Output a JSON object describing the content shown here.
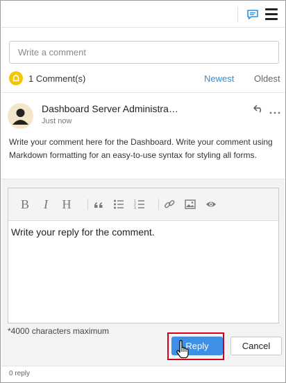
{
  "header": {
    "comment_icon": "comment-icon",
    "menu_icon": "hamburger-menu-icon",
    "accent": "#2f8fd8"
  },
  "new_comment": {
    "placeholder": "Write a comment"
  },
  "summary": {
    "count_label": "1 Comment(s)",
    "sort_newest": "Newest",
    "sort_oldest": "Oldest",
    "bell_color": "#f2c600"
  },
  "comment": {
    "author": "Dashboard Server Administra…",
    "time": "Just now",
    "text": "Write your comment here for the Dashboard. Write your comment using Markdown formatting for an easy-to-use syntax for styling all forms.",
    "reply_icon": "reply-icon",
    "more_icon": "more-options-icon"
  },
  "editor": {
    "toolbar": {
      "bold": "B",
      "italic": "I",
      "heading": "H",
      "icons": [
        "quote-icon",
        "bulleted-list-icon",
        "numbered-list-icon",
        "link-icon",
        "image-icon",
        "preview-eye-icon"
      ]
    },
    "reply_text": "Write your reply for the comment.",
    "max_label": "*4000 characters maximum"
  },
  "actions": {
    "reply_label": "Reply",
    "cancel_label": "Cancel",
    "highlight_color": "#d0021b",
    "reply_color": "#3f8fe6"
  },
  "footer": {
    "reply_count": "0 reply"
  }
}
